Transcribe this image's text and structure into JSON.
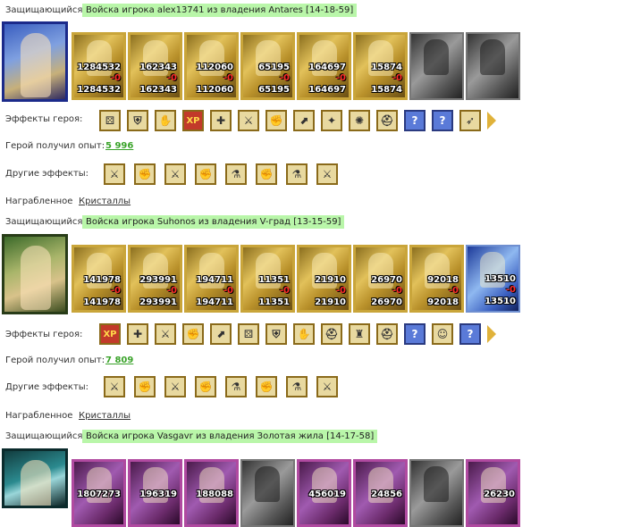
{
  "labels": {
    "defender": "Защищающийся",
    "hero_effects": "Эффекты героя:",
    "exp": "Герой получил опыт:",
    "other": "Другие эффекты:",
    "loot": "Награбленное"
  },
  "battles": [
    {
      "title": "Войска игрока alex13741 из владения Antares [14-18-59]",
      "exp": "5 996",
      "loot": "Кристаллы",
      "units": [
        {
          "top": "1284532",
          "zero": "-0",
          "bottom": "1284532"
        },
        {
          "top": "162343",
          "zero": "-0",
          "bottom": "162343"
        },
        {
          "top": "112060",
          "zero": "-0",
          "bottom": "112060"
        },
        {
          "top": "65195",
          "zero": "-0",
          "bottom": "65195"
        },
        {
          "top": "164697",
          "zero": "-0",
          "bottom": "164697"
        },
        {
          "top": "15874",
          "zero": "-0",
          "bottom": "15874"
        }
      ]
    },
    {
      "title": "Войска игрока Suhonos из владения V-град [13-15-59]",
      "exp": "7 809",
      "loot": "Кристаллы",
      "units": [
        {
          "top": "141978",
          "zero": "-0",
          "bottom": "141978"
        },
        {
          "top": "293991",
          "zero": "-0",
          "bottom": "293991"
        },
        {
          "top": "194711",
          "zero": "-0",
          "bottom": "194711"
        },
        {
          "top": "11351",
          "zero": "-0",
          "bottom": "11351"
        },
        {
          "top": "21910",
          "zero": "-0",
          "bottom": "21910"
        },
        {
          "top": "26970",
          "zero": "-0",
          "bottom": "26970"
        },
        {
          "top": "92018",
          "zero": "-0",
          "bottom": "92018"
        },
        {
          "top": "13510",
          "zero": "-0",
          "bottom": "13510"
        }
      ]
    },
    {
      "title": "Войска игрока Vasgavr из владения Золотая жила [14-17-58]",
      "units": [
        {
          "top": "1807273"
        },
        {
          "top": "196319"
        },
        {
          "top": "188088"
        },
        {
          "top": "456019"
        },
        {
          "top": "24856"
        },
        {
          "top": "26230"
        }
      ]
    }
  ],
  "effect_icons": {
    "xp": "XP",
    "question": "?"
  }
}
